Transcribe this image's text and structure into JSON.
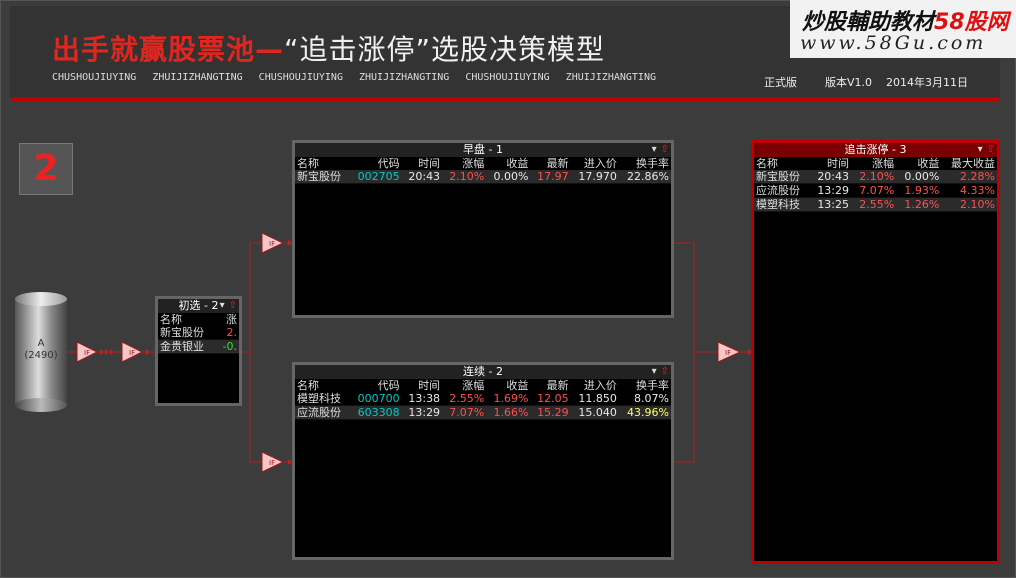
{
  "header": {
    "title_red": "出手就赢股票池—",
    "title_white": "“追击涨停”选股决策模型",
    "subtitle_words": [
      "CHUSHOUJIUYING",
      "ZHUIJIZHANGTING",
      "CHUSHOUJIUYING",
      "ZHUIJIZHANGTING",
      "CHUSHOUJIUYING",
      "ZHUIJIZHANGTING"
    ],
    "edition": "正式版",
    "version": "版本V1.0",
    "date": "2014年3月11日"
  },
  "watermark": {
    "line1_black": "炒股輔助教材",
    "line1_red": "58股网",
    "line2": "www.58Gu.com"
  },
  "badge": "2",
  "cylinder_label": "A\n(2490)",
  "colors": {
    "accent_red": "#c00000",
    "link_red": "#c02020",
    "code_cyan": "#00c8c8",
    "price_yellow": "#ffff66"
  },
  "panels": {
    "chuxuan": {
      "title": "初选 - 2",
      "columns": [
        "名称",
        "涨"
      ],
      "rows": [
        {
          "name": "新宝股份",
          "chg": "2."
        },
        {
          "name": "金贵银业",
          "chg": "-0."
        }
      ]
    },
    "zaopan": {
      "title": "早盘 - 1",
      "columns": [
        "名称",
        "代码",
        "时间",
        "涨幅",
        "收益",
        "最新",
        "进入价",
        "换手率"
      ],
      "rows": [
        {
          "name": "新宝股份",
          "code": "002705",
          "time": "20:43",
          "chg": "2.10%",
          "gain": "0.00%",
          "last": "17.97",
          "entry": "17.970",
          "turnover": "22.86%"
        }
      ]
    },
    "lianxu": {
      "title": "连续 - 2",
      "columns": [
        "名称",
        "代码",
        "时间",
        "涨幅",
        "收益",
        "最新",
        "进入价",
        "换手率"
      ],
      "rows": [
        {
          "name": "模塑科技",
          "code": "000700",
          "time": "13:38",
          "chg": "2.55%",
          "gain": "1.69%",
          "last": "12.05",
          "entry": "11.850",
          "turnover": "8.07%"
        },
        {
          "name": "应流股份",
          "code": "603308",
          "time": "13:29",
          "chg": "7.07%",
          "gain": "1.66%",
          "last": "15.29",
          "entry": "15.040",
          "turnover": "43.96%"
        }
      ]
    },
    "zhuiji": {
      "title": "追击涨停 - 3",
      "columns": [
        "名称",
        "时间",
        "涨幅",
        "收益",
        "最大收益"
      ],
      "rows": [
        {
          "name": "新宝股份",
          "time": "20:43",
          "chg": "2.10%",
          "gain": "0.00%",
          "max": "2.28%"
        },
        {
          "name": "应流股份",
          "time": "13:29",
          "chg": "7.07%",
          "gain": "1.93%",
          "max": "4.33%"
        },
        {
          "name": "模塑科技",
          "time": "13:25",
          "chg": "2.55%",
          "gain": "1.26%",
          "max": "2.10%"
        }
      ]
    }
  },
  "icons": {
    "filter_node": "filter-triangle-icon",
    "dropdown": "dropdown-icon",
    "collapse": "collapse-arrow-icon"
  }
}
